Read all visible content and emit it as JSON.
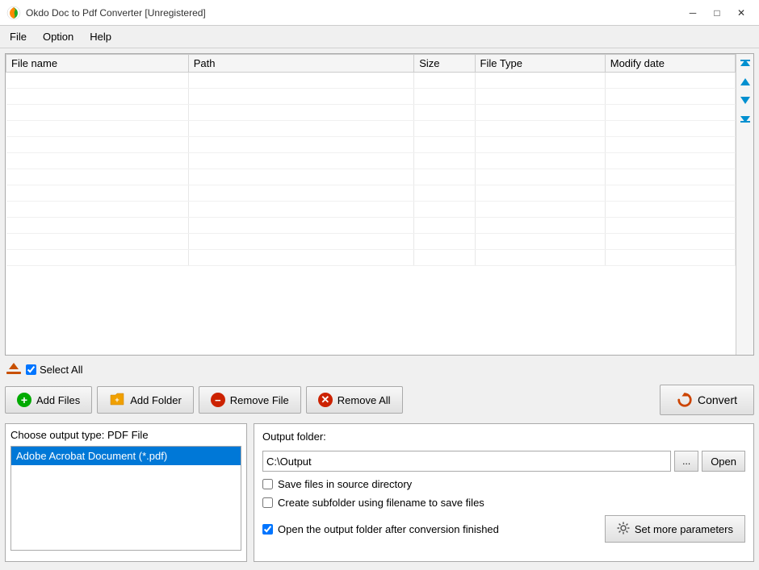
{
  "window": {
    "title": "Okdo Doc to Pdf Converter [Unregistered]"
  },
  "titlebar": {
    "minimize_label": "─",
    "maximize_label": "□",
    "close_label": "✕"
  },
  "menu": {
    "items": [
      {
        "label": "File"
      },
      {
        "label": "Option"
      },
      {
        "label": "Help"
      }
    ]
  },
  "file_table": {
    "columns": [
      {
        "key": "filename",
        "label": "File name"
      },
      {
        "key": "path",
        "label": "Path"
      },
      {
        "key": "size",
        "label": "Size"
      },
      {
        "key": "filetype",
        "label": "File Type"
      },
      {
        "key": "modifydate",
        "label": "Modify date"
      }
    ],
    "rows": []
  },
  "scroll_arrows": {
    "top_label": "⇈",
    "up_label": "↑",
    "down_label": "↓",
    "bottom_label": "⇊"
  },
  "toolbar": {
    "select_all_label": "Select All",
    "add_files_label": "Add Files",
    "add_folder_label": "Add Folder",
    "remove_file_label": "Remove File",
    "remove_all_label": "Remove All",
    "convert_label": "Convert"
  },
  "output_type": {
    "label": "Choose output type:",
    "type_name": "PDF File",
    "items": [
      {
        "label": "Adobe Acrobat Document (*.pdf)",
        "selected": true
      }
    ]
  },
  "output_folder": {
    "label": "Output folder:",
    "path": "C:\\Output",
    "browse_label": "...",
    "open_label": "Open",
    "checkboxes": [
      {
        "id": "cb1",
        "label": "Save files in source directory",
        "checked": false
      },
      {
        "id": "cb2",
        "label": "Create subfolder using filename to save files",
        "checked": false
      },
      {
        "id": "cb3",
        "label": "Open the output folder after conversion finished",
        "checked": true
      }
    ],
    "set_params_label": "Set more parameters"
  }
}
